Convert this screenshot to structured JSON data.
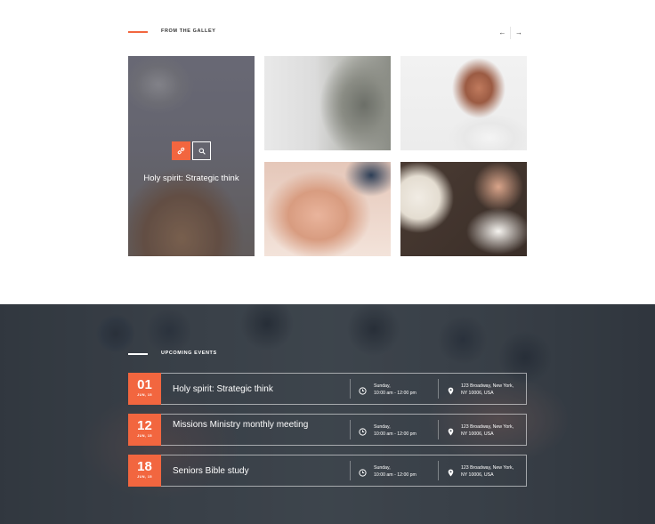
{
  "gallery": {
    "title": "FROM THE GALLEY",
    "nav": {
      "prev_icon": "arrow-left-icon",
      "next_icon": "arrow-right-icon",
      "prev": "←",
      "next": "→"
    },
    "featured": {
      "caption": "Holy spirit: Strategic think",
      "link_icon": "link-icon",
      "zoom_icon": "magnifier-icon"
    },
    "accent_color": "#f2663f"
  },
  "events": {
    "title": "UPCOMING EVENTS",
    "items": [
      {
        "day": "01",
        "month": "JUN, 15",
        "name": "Holy spirit: Strategic think",
        "time_line1": "Sunday,",
        "time_line2": "10:00 am - 12:00 pm",
        "addr_line1": "123 Broadway, New York,",
        "addr_line2": "NY 10006, USA"
      },
      {
        "day": "12",
        "month": "JUN, 15",
        "name": "Missions Ministry monthly meeting",
        "time_line1": "Sunday,",
        "time_line2": "10:00 am - 12:00 pm",
        "addr_line1": "123 Broadway, New York,",
        "addr_line2": "NY 10006, USA"
      },
      {
        "day": "18",
        "month": "JUN, 15",
        "name": "Seniors Bible study",
        "time_line1": "Sunday,",
        "time_line2": "10:00 am - 12:00 pm",
        "addr_line1": "123 Broadway, New York,",
        "addr_line2": "NY 10006, USA"
      }
    ]
  }
}
